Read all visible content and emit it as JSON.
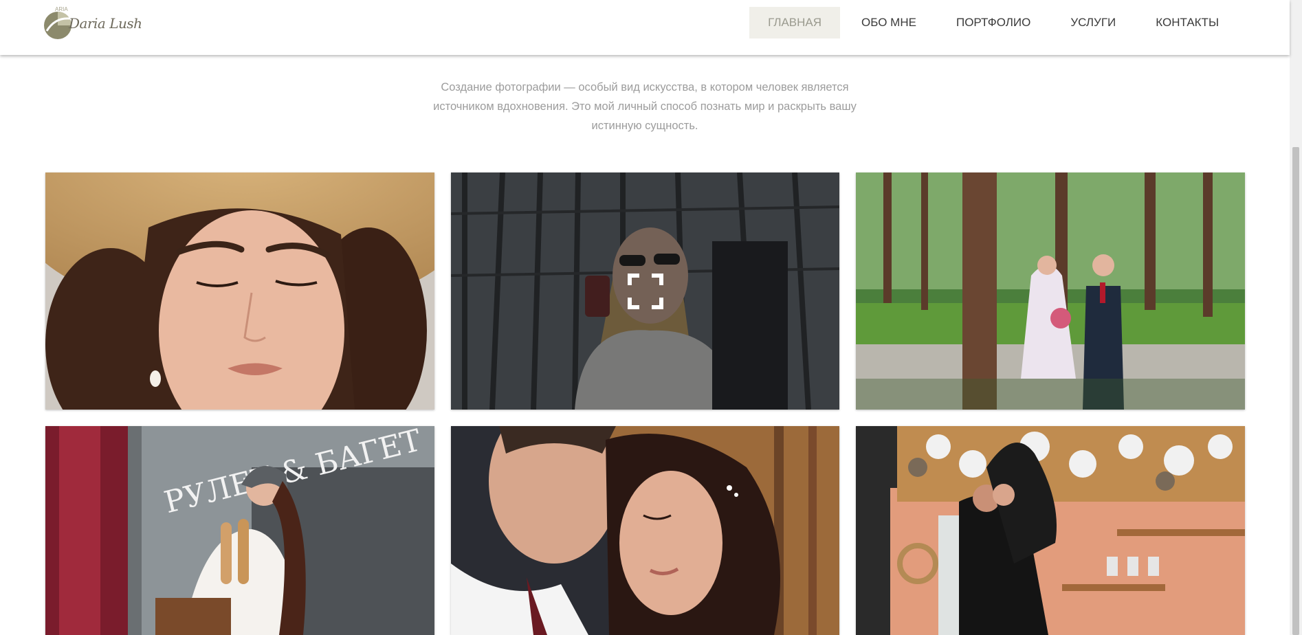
{
  "header": {
    "logo_text": "Daria Lush",
    "logo_small": "ARIA"
  },
  "nav": {
    "items": [
      {
        "label": "ГЛАВНАЯ",
        "active": true
      },
      {
        "label": "ОБО МНЕ"
      },
      {
        "label": "ПОРТФОЛИО"
      },
      {
        "label": "УСЛУГИ"
      },
      {
        "label": "КОНТАКТЫ"
      }
    ]
  },
  "intro": {
    "text": "Создание фотографии — особый вид искусства, в котором человек является источником вдохновения. Это мой личный способ познать мир и раскрыть вашу истинную сущность."
  },
  "gallery": {
    "photos": [
      {
        "name": "photo-woman-straw-hat",
        "hovered": false
      },
      {
        "name": "photo-woman-sunglasses-drink",
        "hovered": true,
        "overlay_icon": "expand-icon"
      },
      {
        "name": "photo-wedding-couple-forest",
        "hovered": false
      },
      {
        "name": "photo-woman-bakery-window",
        "hovered": false,
        "sign_text": "РУЛЕТ & БАГЕТ"
      },
      {
        "name": "photo-couple-embrace",
        "hovered": false
      },
      {
        "name": "photo-couple-kitchen",
        "hovered": false
      }
    ]
  },
  "colors": {
    "nav_active_bg": "#f0efe9",
    "intro_text": "#9c9c9c"
  }
}
